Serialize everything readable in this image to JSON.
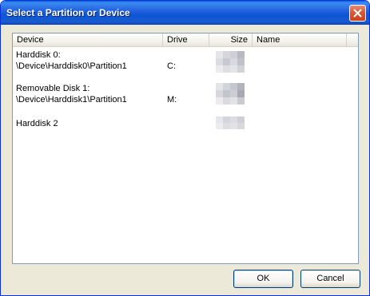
{
  "window": {
    "title": "Select a Partition or Device",
    "title_color": "#0a5fd8"
  },
  "listview": {
    "columns": [
      {
        "label": "Device"
      },
      {
        "label": "Drive"
      },
      {
        "label": "Size"
      },
      {
        "label": "Name"
      }
    ],
    "rows": [
      {
        "device_line1": "Harddisk 0:",
        "device_line2": "\\Device\\Harddisk0\\Partition1",
        "drive": "C:",
        "size_redacted": true,
        "name": ""
      },
      {
        "device_line1": "Removable Disk 1:",
        "device_line2": "\\Device\\Harddisk1\\Partition1",
        "drive": "M:",
        "size_redacted": true,
        "name": ""
      },
      {
        "device_line1": "Harddisk 2",
        "device_line2": "",
        "drive": "",
        "size_redacted": true,
        "name": ""
      }
    ]
  },
  "buttons": {
    "ok_label": "OK",
    "cancel_label": "Cancel"
  },
  "icons": {
    "close": "close-icon"
  }
}
